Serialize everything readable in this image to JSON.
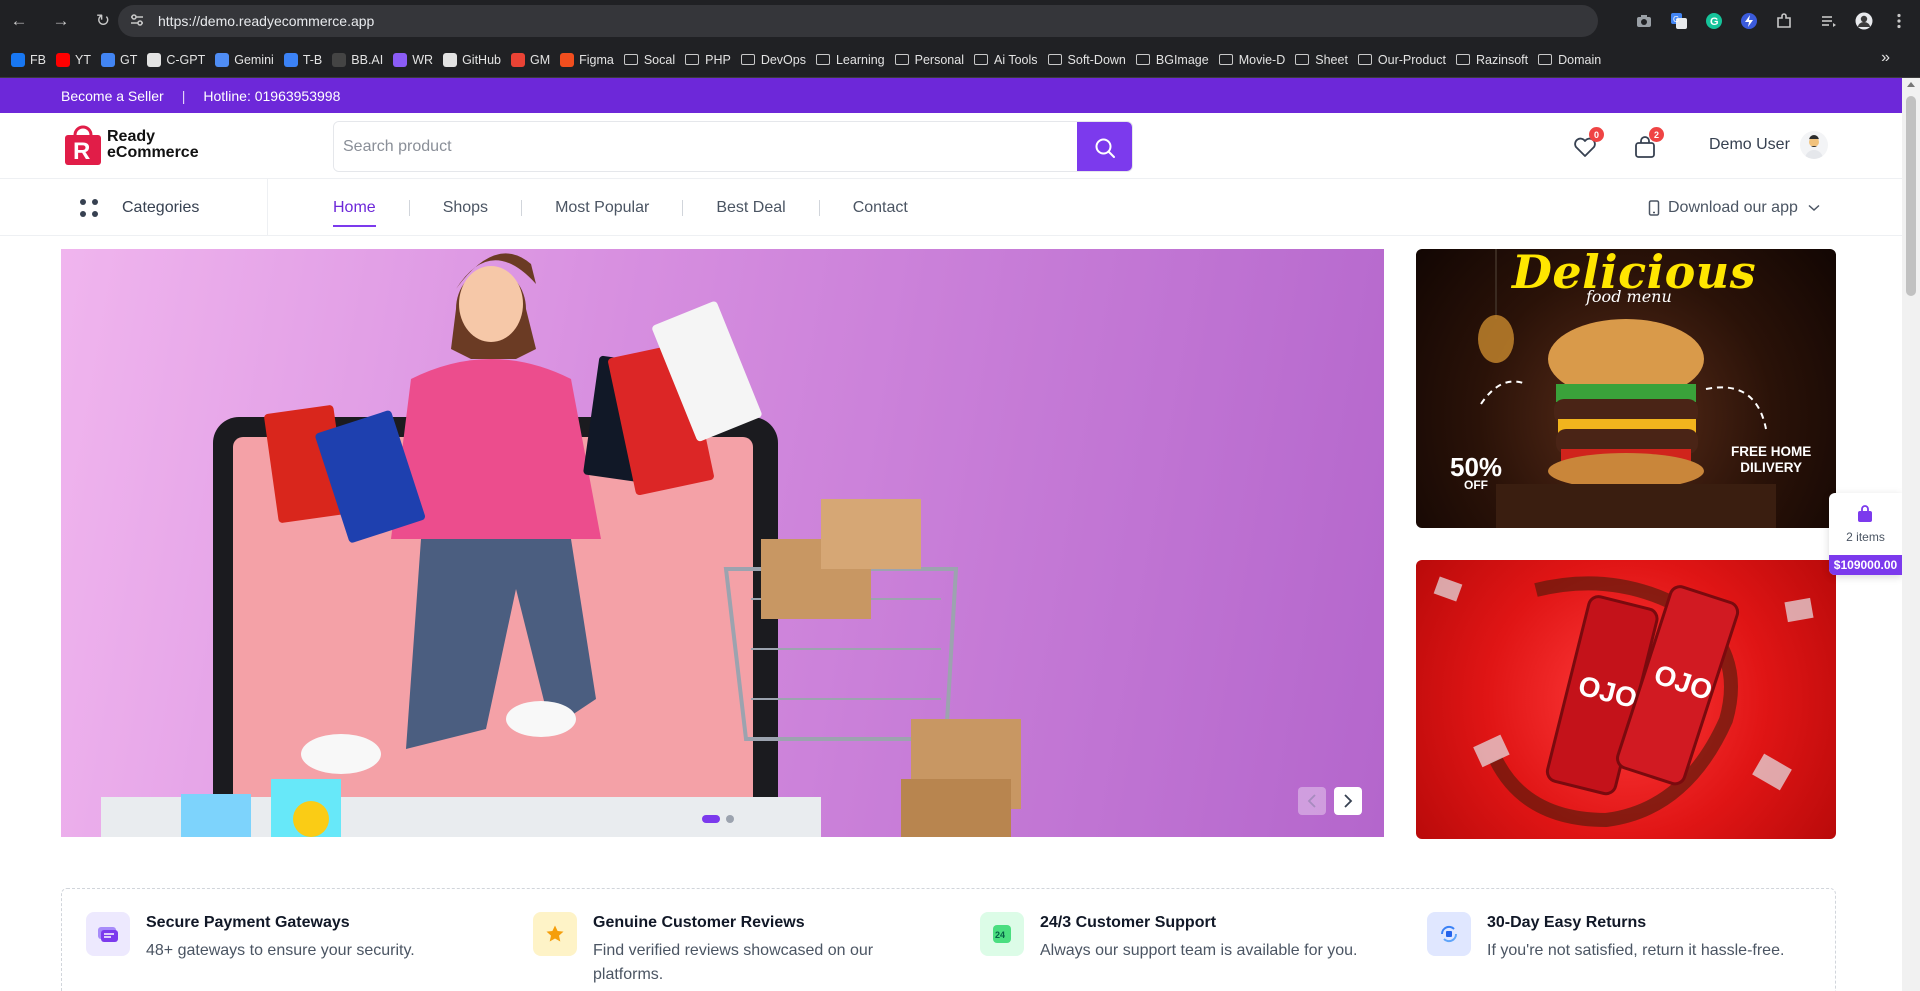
{
  "browser": {
    "url": "https://demo.readyecommerce.app",
    "icons": [
      "back-arrow-icon",
      "forward-arrow-icon",
      "reload-icon",
      "site-settings-icon",
      "camera-icon",
      "translate-icon",
      "grammarly-icon",
      "extension-bolt-icon",
      "puzzle-extensions-icon",
      "reading-list-icon",
      "profile-icon",
      "more-vert-icon"
    ],
    "bookmarks": [
      {
        "label": "FB",
        "icon": "facebook-icon",
        "color": "#1877f2"
      },
      {
        "label": "YT",
        "icon": "youtube-icon",
        "color": "#ff0000"
      },
      {
        "label": "GT",
        "icon": "google-translate-icon",
        "color": "#4285f4"
      },
      {
        "label": "C-GPT",
        "icon": "chatgpt-icon",
        "color": "#e3e3e3"
      },
      {
        "label": "Gemini",
        "icon": "gemini-icon",
        "color": "#4f8df5"
      },
      {
        "label": "T-B",
        "icon": "tb-icon",
        "color": "#3b82f6"
      },
      {
        "label": "BB.AI",
        "icon": "bbai-icon",
        "color": "#444444"
      },
      {
        "label": "WR",
        "icon": "wr-icon",
        "color": "#8b5cf6"
      },
      {
        "label": "GitHub",
        "icon": "github-icon",
        "color": "#e3e3e3"
      },
      {
        "label": "GM",
        "icon": "gmail-icon",
        "color": "#ea4335"
      },
      {
        "label": "Figma",
        "icon": "figma-icon",
        "color": "#f24e1e"
      },
      {
        "label": "Socal",
        "folder": true
      },
      {
        "label": "PHP",
        "folder": true
      },
      {
        "label": "DevOps",
        "folder": true
      },
      {
        "label": "Learning",
        "folder": true
      },
      {
        "label": "Personal",
        "folder": true
      },
      {
        "label": "Ai Tools",
        "folder": true
      },
      {
        "label": "Soft-Down",
        "folder": true
      },
      {
        "label": "BGImage",
        "folder": true
      },
      {
        "label": "Movie-D",
        "folder": true
      },
      {
        "label": "Sheet",
        "folder": true
      },
      {
        "label": "Our-Product",
        "folder": true
      },
      {
        "label": "Razinsoft",
        "folder": true
      },
      {
        "label": "Domain",
        "folder": true
      }
    ],
    "more_bookmarks": "»"
  },
  "topbar": {
    "seller": "Become a Seller",
    "separator": "|",
    "hotline": "Hotline: 01963953998",
    "color": "#6d28d9"
  },
  "header": {
    "logo_line1": "Ready",
    "logo_line2": "eCommerce",
    "logo_letter": "R",
    "search_placeholder": "Search product",
    "wishlist_count": "0",
    "cart_count": "2",
    "user_name": "Demo User",
    "accent": "#7c3aed"
  },
  "nav": {
    "categories": "Categories",
    "items": [
      "Home",
      "Shops",
      "Most Popular",
      "Best Deal",
      "Contact"
    ],
    "active": "Home",
    "download": "Download our app"
  },
  "promos": {
    "food_title": "Delicious",
    "food_sub": "food menu",
    "food_off_pct": "50%",
    "food_off": "OFF",
    "food_delivery_1": "FREE HOME",
    "food_delivery_2": "DILIVERY",
    "drink_brand": "OJO"
  },
  "float_cart": {
    "items": "2 items",
    "total": "$109000.00"
  },
  "features": [
    {
      "title": "Secure Payment Gateways",
      "desc": "48+ gateways to ensure your security.",
      "icon": "payment-card-icon",
      "bg": "#ede9fe"
    },
    {
      "title": "Genuine Customer Reviews",
      "desc": "Find verified reviews showcased on our platforms.",
      "icon": "star-icon",
      "bg": "#fef3c7"
    },
    {
      "title": "24/3 Customer Support",
      "desc": "Always our support team is available for you.",
      "icon": "support-24-icon",
      "badge": "24",
      "bg": "#dcfce7"
    },
    {
      "title": "30-Day Easy Returns",
      "desc": "If you're not satisfied, return it hassle-free.",
      "icon": "returns-icon",
      "bg": "#e0e7ff"
    }
  ]
}
